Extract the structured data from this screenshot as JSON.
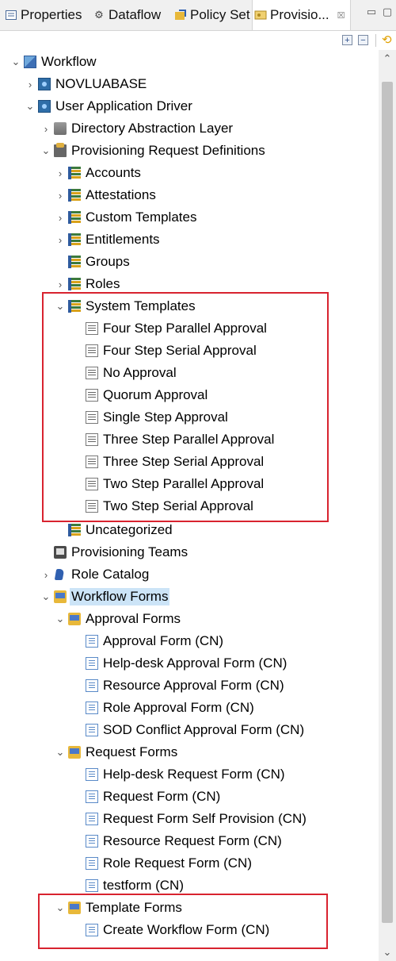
{
  "tabs": [
    {
      "label": "Properties",
      "icon": "properties-icon"
    },
    {
      "label": "Dataflow",
      "icon": "dataflow-icon"
    },
    {
      "label": "Policy Set",
      "icon": "policy-set-icon"
    },
    {
      "label": "Provisio...",
      "icon": "provisioning-view-icon"
    }
  ],
  "tree": {
    "workflow": "Workflow",
    "novluabase": "NOVLUABASE",
    "uad": "User Application Driver",
    "dal": "Directory Abstraction Layer",
    "prd": "Provisioning Request Definitions",
    "categories": [
      "Accounts",
      "Attestations",
      "Custom Templates",
      "Entitlements",
      "Groups",
      "Roles"
    ],
    "system_templates": "System Templates",
    "templates": [
      "Four Step Parallel Approval",
      "Four Step Serial Approval",
      "No Approval",
      "Quorum Approval",
      "Single Step Approval",
      "Three Step Parallel Approval",
      "Three Step Serial Approval",
      "Two Step Parallel Approval",
      "Two Step Serial Approval"
    ],
    "uncategorized": "Uncategorized",
    "provisioning_teams": "Provisioning Teams",
    "role_catalog": "Role Catalog",
    "workflow_forms": "Workflow Forms",
    "approval_forms": "Approval Forms",
    "approval_form_items": [
      "Approval Form (CN)",
      "Help-desk Approval Form (CN)",
      "Resource Approval Form (CN)",
      "Role Approval Form (CN)",
      "SOD Conflict Approval Form (CN)"
    ],
    "request_forms": "Request Forms",
    "request_form_items": [
      "Help-desk Request Form (CN)",
      "Request Form (CN)",
      "Request Form Self Provision (CN)",
      "Resource Request Form (CN)",
      "Role Request Form (CN)",
      "testform (CN)"
    ],
    "template_forms": "Template Forms",
    "template_form_items": [
      "Create Workflow Form (CN)"
    ]
  },
  "colors": {
    "highlight_box": "#d8232f",
    "selection": "#cce4f7"
  }
}
